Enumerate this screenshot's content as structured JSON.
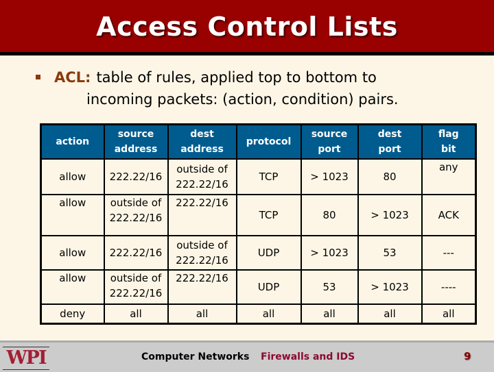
{
  "slide": {
    "title": "Access Control Lists",
    "bullet": {
      "term": "ACL:",
      "text_line1": "table of rules, applied top to bottom to",
      "text_line2": "incoming packets: (action, condition) pairs."
    }
  },
  "table": {
    "headers": [
      [
        "action"
      ],
      [
        "source",
        "address"
      ],
      [
        "dest",
        "address"
      ],
      [
        "protocol"
      ],
      [
        "source",
        "port"
      ],
      [
        "dest",
        "port"
      ],
      [
        "flag",
        "bit"
      ]
    ],
    "rows": [
      {
        "action": "allow",
        "source_address": [
          "222.22/16"
        ],
        "dest_address": [
          "outside of",
          "222.22/16"
        ],
        "protocol": "TCP",
        "source_port": "> 1023",
        "dest_port": "80",
        "flag_bit": "any"
      },
      {
        "action": "allow",
        "source_address": [
          "outside of",
          "222.22/16"
        ],
        "dest_address": [
          "222.22/16"
        ],
        "protocol": "TCP",
        "source_port": "80",
        "dest_port": "> 1023",
        "flag_bit": "ACK"
      },
      {
        "action": "allow",
        "source_address": [
          "222.22/16"
        ],
        "dest_address": [
          "outside of",
          "222.22/16"
        ],
        "protocol": "UDP",
        "source_port": "> 1023",
        "dest_port": "53",
        "flag_bit": "---"
      },
      {
        "action": "allow",
        "source_address": [
          "outside of",
          "222.22/16"
        ],
        "dest_address": [
          "222.22/16"
        ],
        "protocol": "UDP",
        "source_port": "53",
        "dest_port": "> 1023",
        "flag_bit": "----"
      },
      {
        "action": "deny",
        "source_address": [
          "all"
        ],
        "dest_address": [
          "all"
        ],
        "protocol": "all",
        "source_port": "all",
        "dest_port": "all",
        "flag_bit": "all"
      }
    ]
  },
  "footer": {
    "logo": "WPI",
    "course": "Computer Networks",
    "topic": "Firewalls and IDS",
    "page_number": "9"
  },
  "colors": {
    "title_bar": "#990000",
    "header_fill": "#005c8f",
    "background": "#fdf6e6",
    "accent": "#8b3a0e"
  }
}
